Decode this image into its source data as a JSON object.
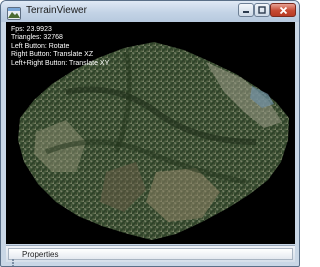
{
  "window": {
    "title": "TerrainViewer",
    "icon": "terrain-app-icon"
  },
  "title_controls": {
    "minimize_icon": "minimize-icon",
    "maximize_icon": "maximize-icon",
    "close_icon": "close-icon"
  },
  "hud": {
    "fps": "Fps: 23.9923",
    "triangles": "Triangles: 32768",
    "left_button": "Left Button: Rotate",
    "right_button": "Right Button: Translate XZ",
    "both_buttons": "Left+Right Button: Translate XY"
  },
  "statusbar": {
    "properties_label": "Properties"
  },
  "colors": {
    "viewport_background": "#000000",
    "titlebar": "#c3d3e6",
    "close_button": "#c64a33",
    "hud_text": "#ffffff"
  }
}
